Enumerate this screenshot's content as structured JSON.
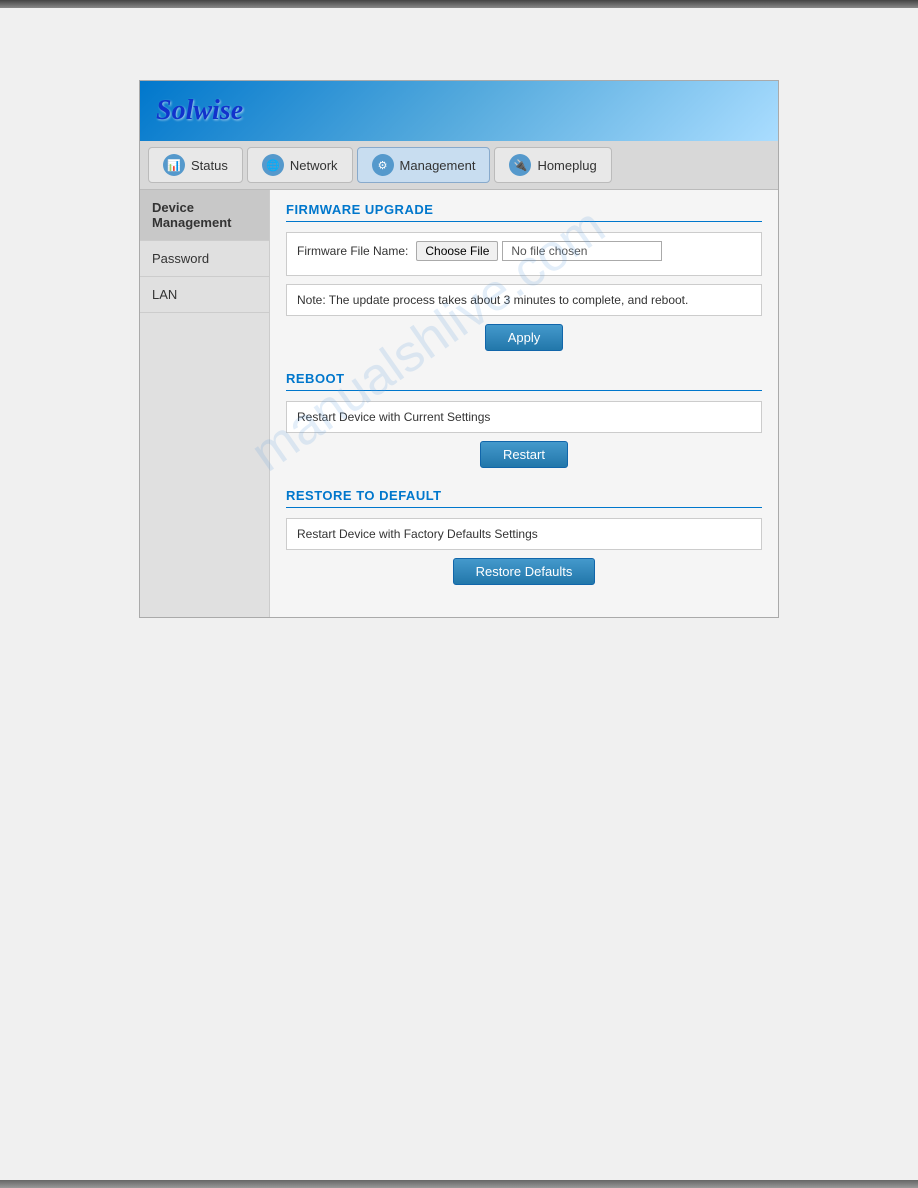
{
  "header": {
    "logo": "Solwise"
  },
  "nav": {
    "tabs": [
      {
        "id": "status",
        "label": "Status",
        "icon": "📊"
      },
      {
        "id": "network",
        "label": "Network",
        "icon": "🌐"
      },
      {
        "id": "management",
        "label": "Management",
        "icon": "⚙"
      },
      {
        "id": "homeplug",
        "label": "Homeplug",
        "icon": "🔌"
      }
    ]
  },
  "sidebar": {
    "items": [
      {
        "id": "device-management",
        "label": "Device Management"
      },
      {
        "id": "password",
        "label": "Password"
      },
      {
        "id": "lan",
        "label": "LAN"
      }
    ]
  },
  "firmware_upgrade": {
    "section_title": "FIRMWARE UPGRADE",
    "file_label": "Firmware File Name:",
    "choose_file_btn": "Choose File",
    "file_placeholder": "No file chosen",
    "note": "Note: The update process takes about 3 minutes to complete, and reboot.",
    "apply_btn": "Apply"
  },
  "reboot": {
    "section_title": "REBOOT",
    "description": "Restart Device with Current Settings",
    "restart_btn": "Restart"
  },
  "restore_default": {
    "section_title": "RESTORE TO DEFAULT",
    "description": "Restart Device with Factory Defaults Settings",
    "restore_btn": "Restore Defaults"
  },
  "watermark": "manualshlive.com"
}
